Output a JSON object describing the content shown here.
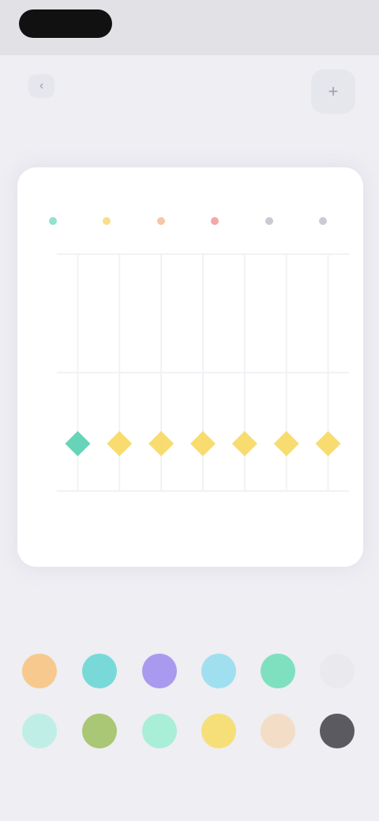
{
  "status": {
    "time": "",
    "right": ""
  },
  "nav": {
    "back_label": "",
    "title": "",
    "action_icon": "plus-icon"
  },
  "card": {
    "title": "",
    "legend": [
      {
        "label": "",
        "color": "#8fe3cf"
      },
      {
        "label": "",
        "color": "#f7e08a"
      },
      {
        "label": "",
        "color": "#f7c6a8"
      },
      {
        "label": "",
        "color": "#f4a7a7"
      },
      {
        "label": "",
        "color": "#c9cbd1"
      },
      {
        "label": "",
        "color": "#c9cbd1"
      }
    ]
  },
  "chart_data": {
    "type": "scatter",
    "x": [
      1,
      2,
      3,
      4,
      5,
      6,
      7
    ],
    "series": [
      {
        "color": "#57cfb0",
        "values": [
          1,
          null,
          null,
          null,
          null,
          null,
          null
        ]
      },
      {
        "color": "#f7d860",
        "values": [
          null,
          1,
          1,
          1,
          1,
          1,
          1
        ]
      }
    ],
    "ylim": [
      0,
      5
    ],
    "grid": true
  },
  "palette": {
    "row1": [
      {
        "name": "orange",
        "color": "#f7c98f"
      },
      {
        "name": "teal",
        "color": "#79d9d9"
      },
      {
        "name": "purple",
        "color": "#a99af0"
      },
      {
        "name": "sky",
        "color": "#9fdff0"
      },
      {
        "name": "mint",
        "color": "#7fe0c0"
      },
      {
        "name": "light-gray",
        "color": "#e9e9ee"
      }
    ],
    "row2": [
      {
        "name": "aqua",
        "color": "#bfeee6"
      },
      {
        "name": "olive",
        "color": "#a9c774"
      },
      {
        "name": "seafoam",
        "color": "#a9eed7"
      },
      {
        "name": "yellow",
        "color": "#f6df78"
      },
      {
        "name": "peach",
        "color": "#f3ddc7"
      },
      {
        "name": "dark-gray",
        "color": "#5a5a60"
      }
    ]
  }
}
